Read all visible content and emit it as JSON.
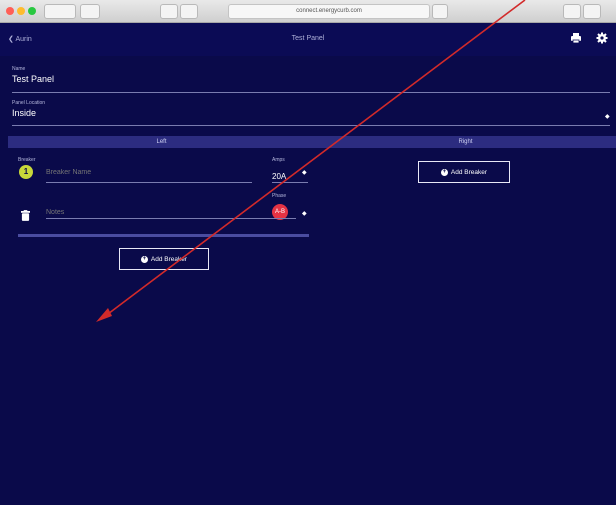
{
  "browser": {
    "url": "connect.energycurb.com"
  },
  "navbar": {
    "back_label": "Aurin",
    "title": "Test Panel"
  },
  "form": {
    "name_label": "Name",
    "name_value": "Test Panel",
    "location_label": "Panel Location",
    "location_value": "Inside"
  },
  "columns": {
    "left": "Left",
    "right": "Right"
  },
  "breaker": {
    "section_label": "Breaker",
    "number": "1",
    "name_placeholder": "Breaker Name",
    "amps_label": "Amps",
    "amps_value": "20A",
    "phase_label": "Phase",
    "phase_value": "A-B",
    "notes_label": "Notes"
  },
  "buttons": {
    "add_breaker_left": "Add Breaker",
    "add_breaker_right": "Add Breaker"
  },
  "colors": {
    "background": "#0a0a4a",
    "navbar": "#0b0b55",
    "column_header": "#2c2c80",
    "breaker_badge": "#c8d83a",
    "phase_badge": "#e53344",
    "arrow": "#d22a2a"
  }
}
